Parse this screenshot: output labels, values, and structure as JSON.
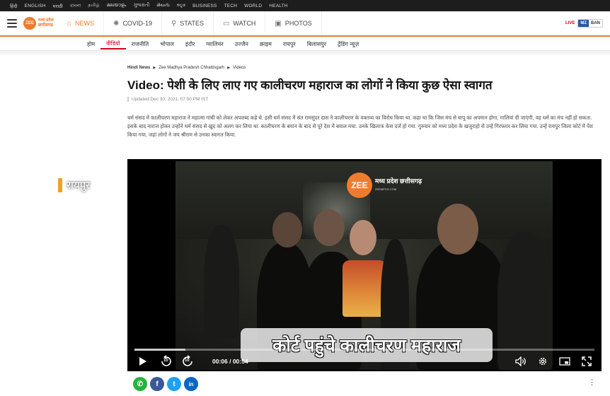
{
  "lang_bar": [
    "हिंदी",
    "ENGLISH",
    "मराठी",
    "বাংলা",
    "தமிழ்",
    "മലയാളം",
    "ગુજરાતી",
    "తెలుగు",
    "ಕನ್ನಡ",
    "BUSINESS",
    "TECH",
    "WORLD",
    "HEALTH"
  ],
  "logo": {
    "mark": "ZEE",
    "name": "मध्य प्रदेश छत्तीसगढ़"
  },
  "nav": {
    "tabs": [
      {
        "label": "NEWS",
        "icon": "home-icon"
      },
      {
        "label": "COVID-19",
        "icon": "virus-icon"
      },
      {
        "label": "STATES",
        "icon": "location-pin-icon"
      },
      {
        "label": "WATCH",
        "icon": "tv-icon"
      },
      {
        "label": "PHOTOS",
        "icon": "image-icon"
      }
    ],
    "live": "LIVE",
    "lang_on": "MZ",
    "lang_off": "BAN"
  },
  "subnav": [
    "होम",
    "वीडियो",
    "राजनीति",
    "भोपाल",
    "इंदौर",
    "ग्वालियर",
    "उज्जैन",
    "क्राइम",
    "रायपुर",
    "बिलासपुर",
    "ट्रेंडिंग न्यूज़"
  ],
  "article": {
    "breadcrumb": [
      "Hindi News",
      "Zee Madhya Pradesh Chhattisgarh",
      "Videos"
    ],
    "headline": "Video: पेशी के लिए लाए गए कालीचरण महाराज का लोगों ने किया कुछ ऐसा स्वागत",
    "updated": "Updated:Dec 30, 2021, 07:50 PM IST",
    "body": "धर्म संसद में कालीचरण महाराज ने महात्मा गांधी को लेकर अपशब्द कहे थे. इसी धर्म संसद में संत रामसुंदर दास ने कालीचरण के वक्तव्य का विरोध किया था. कहा था कि जिस मंच से बापू का अपमान होगा, गालियां दी जाएंगी, वह धर्म का मंच नहीं हो सकता. इसके बाद नाराज होकर उन्होंने धर्म संसद से खुद को अलग कर लिया था. कालीचरण के बयान के बाद से पूरे देश में बवाल मचा. उनके खिलाफ केस दर्ज हो गया. गुरुवार को मध्य प्रदेश के खजुराहो से उन्हें गिरफ्तार कर लिया गया. उन्हें रायपुर जिला कोर्ट में पेश किया गया, जहां लोगों ने जय श्रीराम से उनका स्वागत किया."
  },
  "video": {
    "location": "रायपुर",
    "channel_mark": "ZEE",
    "channel_name": "मध्य प्रदेश छत्तीसगढ़",
    "channel_url": "ZEEMPCG.COM",
    "caption": "कोर्ट पहुंचे कालीचरण महाराज",
    "time": "00:06 / 00:54",
    "progress": 0.111,
    "skip_back": "10",
    "skip_fwd": "10"
  },
  "share": {
    "whatsapp": "✆",
    "facebook": "f",
    "twitter": "t",
    "linkedin": "in",
    "more": "⋮"
  }
}
